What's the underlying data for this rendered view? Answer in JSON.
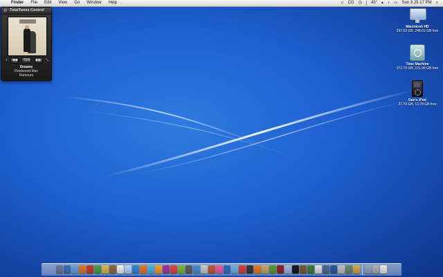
{
  "menubar": {
    "apple_icon": "apple-icon",
    "items": [
      "Finder",
      "File",
      "Edit",
      "View",
      "Go",
      "Window",
      "Help"
    ],
    "status": {
      "music_glyph": "♫",
      "volume_glyph": "♪",
      "battery": "CG",
      "temperature": "43°",
      "clock": "Sun 3 25 17 PM"
    }
  },
  "widget": {
    "title": "TotalTunes Control",
    "close_glyph": "⚙",
    "controls": {
      "add": "+",
      "prev": "◀◀",
      "pause": "TEN",
      "next": "▶▶",
      "expand": "⤡"
    },
    "track": {
      "song": "Dreams",
      "artist": "Fleetwood Mac",
      "album": "Rumours"
    }
  },
  "desktop_icons": [
    {
      "name": "Macintosh HD",
      "info": "297.63 GB, 248.01 GB free",
      "icon": "hard-drive-icon"
    },
    {
      "name": "Time Machine",
      "info": "372.79 GB, 101.96 GB free",
      "icon": "time-machine-icon"
    },
    {
      "name": "Dan's iPod",
      "info": "27.79 GB, 13.78 GB free",
      "icon": "ipod-icon"
    }
  ],
  "dock": {
    "colors": [
      "#6c7a93",
      "#3f6fb5",
      "#6aa0d8",
      "#d97a2b",
      "#c43c2a",
      "#4aa04a",
      "#e0b84a",
      "#8c6a3f",
      "#f0f0f0",
      "#b8d6f2",
      "#3a86d6",
      "#e6762c",
      "#4cb5d8",
      "#f0a030",
      "#9b3b9b",
      "#d94a4a",
      "#7fb43a",
      "#5f5f5f",
      "#4a8fd6",
      "#c9c9c9",
      "#c25a3a",
      "#e85b9c",
      "#2f6fbf",
      "#6ab2e0",
      "#d84040",
      "#3a3a3a",
      "#e27c24",
      "#c7a66a",
      "#5a9a3a",
      "#8a2a2a",
      "#a0b8d8",
      "#1d1d1d",
      "#7a5a3a",
      "#3c7d3c",
      "#e0e0e0",
      "#4f6a8f",
      "#2a5a9a",
      "#c0c0c0",
      "#6a8a6a",
      "#d6a84a",
      "#9aa6b8",
      "#b0b0b0",
      "#e8e8e8"
    ]
  }
}
